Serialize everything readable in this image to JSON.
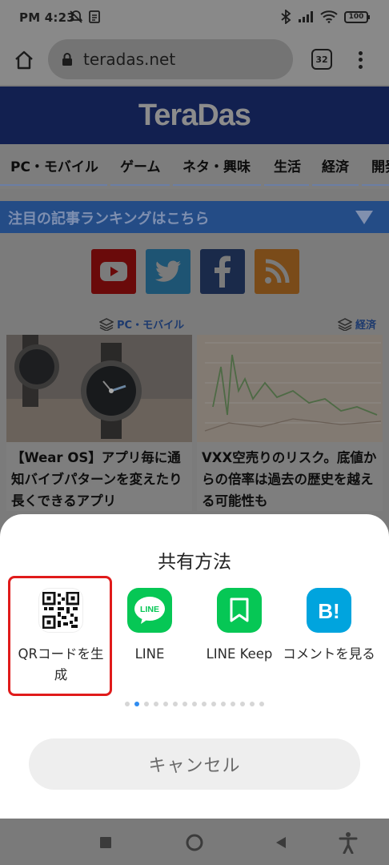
{
  "status_bar": {
    "time": "PM 4:23",
    "battery": "100",
    "icons": [
      "notifications-off-icon",
      "sim-icon",
      "bluetooth-icon",
      "signal-icon",
      "wifi-icon",
      "battery-icon"
    ]
  },
  "browser": {
    "url": "teradas.net",
    "tab_count": "32"
  },
  "site": {
    "logo_text": "TeraDas",
    "nav_items": [
      "PC・モバイル",
      "ゲーム",
      "ネタ・興味",
      "生活",
      "経済",
      "開発"
    ],
    "ranking_banner": "注目の記事ランキングはこちら",
    "social": [
      "youtube-icon",
      "twitter-icon",
      "facebook-icon",
      "rss-icon"
    ],
    "articles": [
      {
        "category": "PC・モバイル",
        "title": "【Wear OS】アプリ毎に通知バイブパターンを変えたり長くできるアプリ"
      },
      {
        "category": "経済",
        "title": "VXX空売りのリスク。底値からの倍率は過去の歴史を越える可能性も"
      }
    ]
  },
  "share_sheet": {
    "title": "共有方法",
    "options": [
      {
        "label": "QRコードを生成",
        "icon": "qr-code-icon"
      },
      {
        "label": "LINE",
        "icon": "line-icon"
      },
      {
        "label": "LINE Keep",
        "icon": "line-keep-icon"
      },
      {
        "label": "コメントを見る",
        "icon": "hatena-bookmark-icon"
      }
    ],
    "page_count": 15,
    "active_page": 2,
    "cancel_label": "キャンセル"
  },
  "colors": {
    "highlight": "#e01b1b",
    "line_green": "#06c755",
    "hatena_blue": "#00a4de",
    "active_dot": "#2f8cf0"
  }
}
